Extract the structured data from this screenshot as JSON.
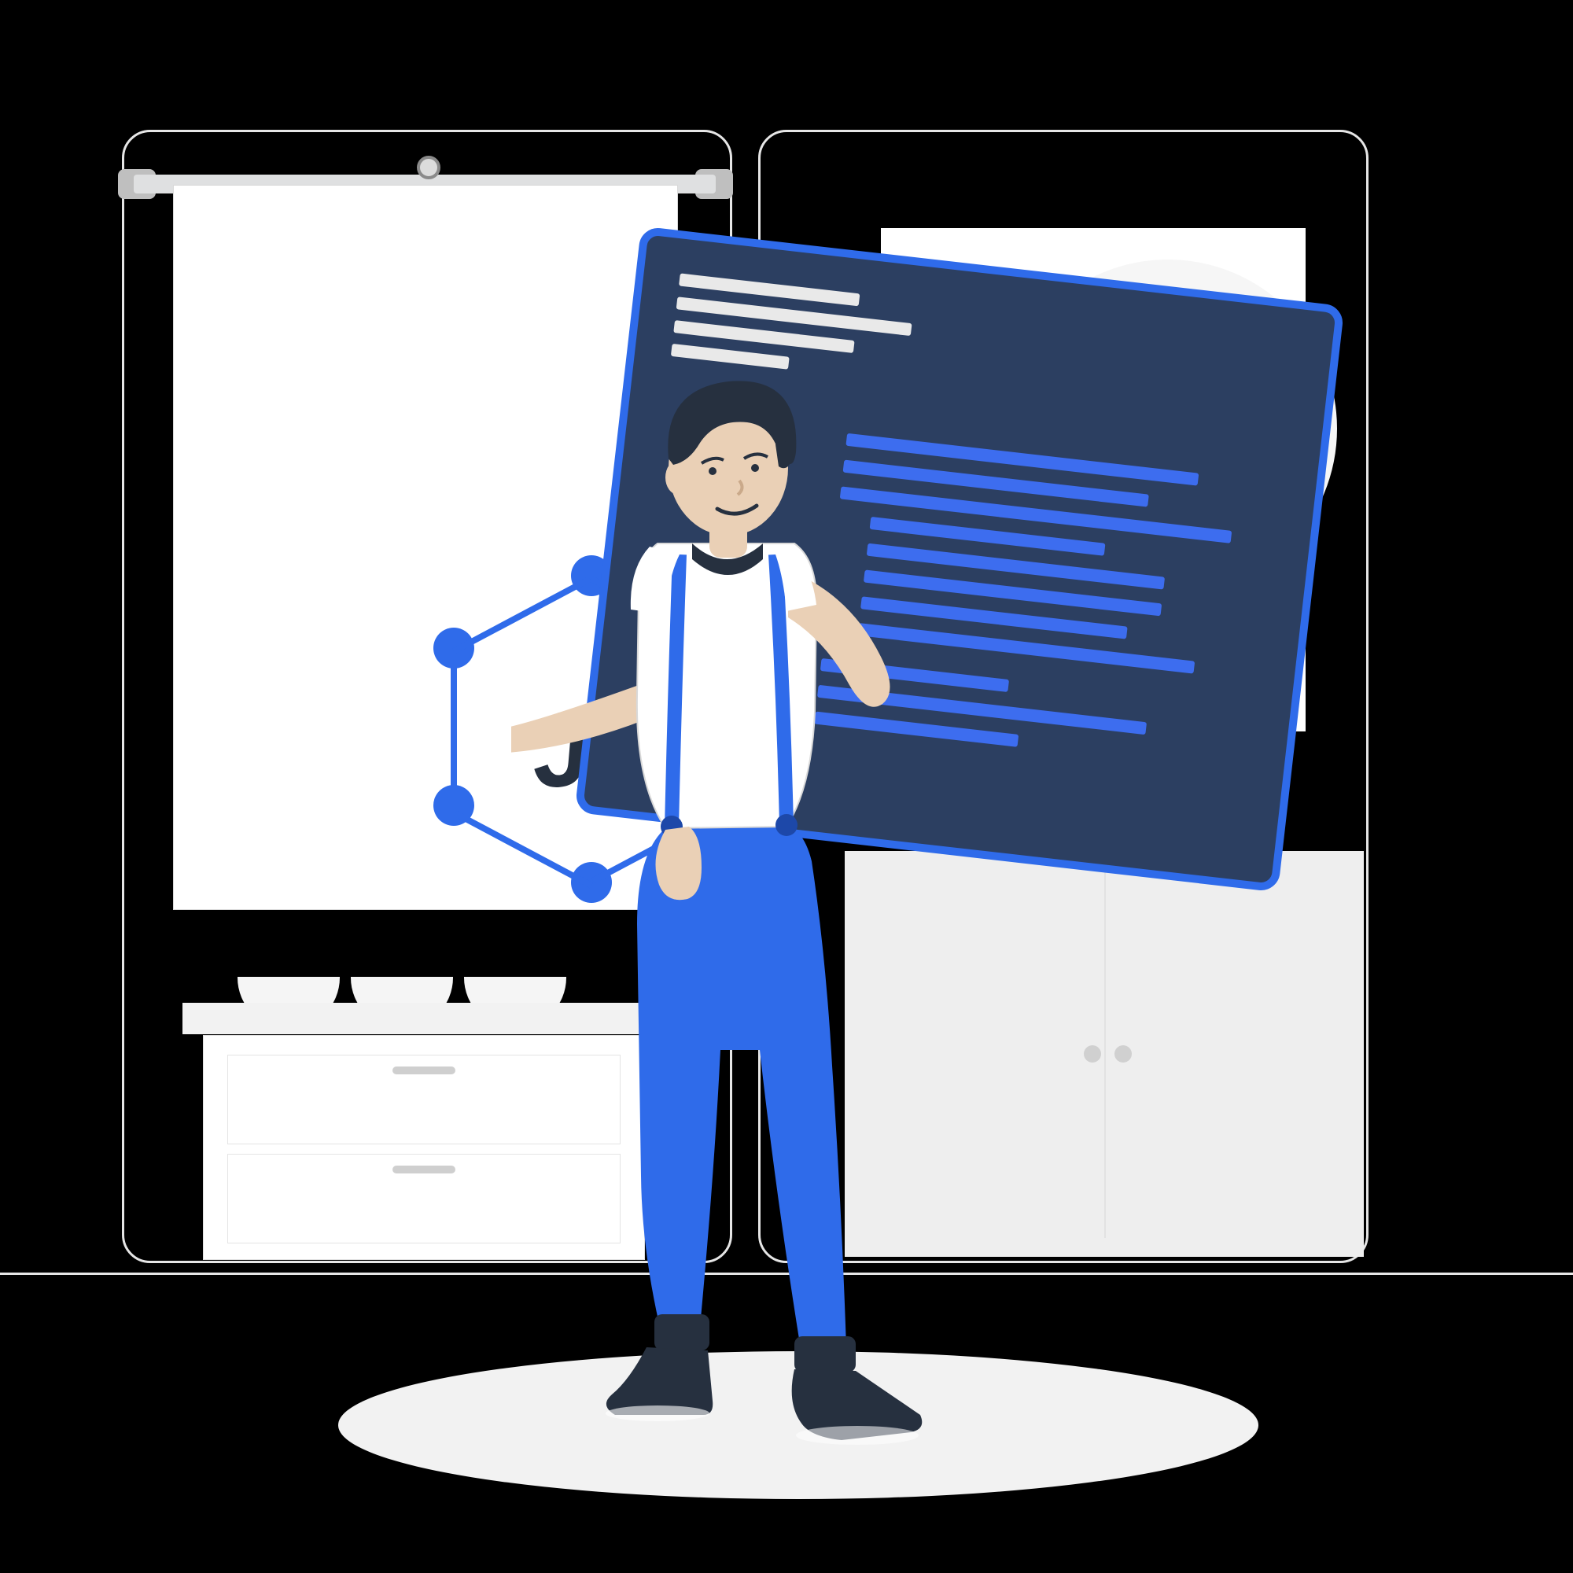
{
  "illustration": {
    "logo_label": "JS",
    "colors": {
      "accent_blue": "#2f6bea",
      "panel_navy": "#2c3f61",
      "dark_text": "#26303f",
      "light_gray": "#e6e6e6",
      "floor_shadow": "#f2f2f2"
    }
  }
}
